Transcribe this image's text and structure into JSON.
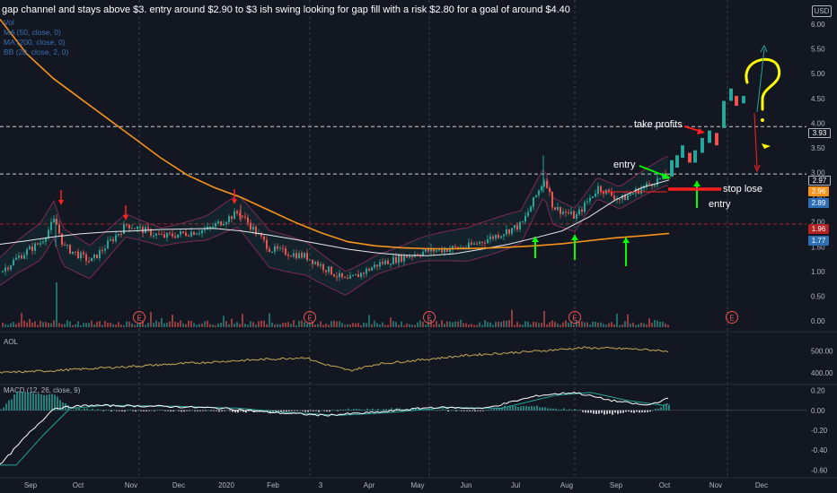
{
  "header": {
    "title": "gap channel and stays above $3. entry around $2.90 to $3 ish  swing looking for gap fill with a risk $2.80 for a goal of around $4.40",
    "currency": "USD"
  },
  "legend": {
    "vol": "Vol",
    "ma50": "MA (50, close, 0)",
    "ma200": "MA (200, close, 0)",
    "bb": "BB (20, close, 2, 0)"
  },
  "annotations": {
    "take_profits": "take profits",
    "entry_top": "entry",
    "stop_lose": "stop lose",
    "entry_bottom": "entry"
  },
  "price_tags": {
    "t393": "3.93",
    "t297": "2.97",
    "t296": "2.96",
    "t289": "2.89",
    "t196": "1.96",
    "t177": "1.77"
  },
  "colors": {
    "up": "#26a69a",
    "down": "#ef5350",
    "ma50": "#ffffff",
    "ma200": "#f7931a",
    "bb": "#7b2a55",
    "aol": "#c8a850",
    "macd": "#ffffff",
    "signal": "#26a69a",
    "tag_orange": "#f7931a",
    "tag_blue": "#2f6fb5",
    "tag_red": "#b22222"
  },
  "chart_data": [
    {
      "type": "line",
      "series": [
        {
          "name": "MA (50, close, 0)",
          "values": [
            1.55,
            1.62,
            1.7,
            1.76,
            1.8,
            1.82,
            1.85,
            1.86,
            1.87,
            1.82,
            1.74,
            1.65,
            1.55,
            1.45,
            1.38,
            1.33,
            1.32,
            1.36,
            1.45,
            1.55,
            1.68,
            1.82,
            2.1,
            2.45,
            2.7,
            2.85
          ]
        },
        {
          "name": "MA (200, close, 0)",
          "values": [
            6.1,
            5.4,
            4.9,
            4.5,
            4.1,
            3.7,
            3.3,
            2.95,
            2.7,
            2.5,
            2.25,
            2.0,
            1.78,
            1.6,
            1.52,
            1.48,
            1.46,
            1.46,
            1.47,
            1.49,
            1.52,
            1.56,
            1.62,
            1.68,
            1.72,
            1.77
          ]
        }
      ],
      "x": [
        "Sep",
        "",
        "Oct",
        "",
        "Nov",
        "",
        "Dec",
        "",
        "2020",
        "",
        "Feb",
        "",
        "3",
        "",
        "Apr",
        "",
        "May",
        "",
        "Jun",
        "",
        "Jul",
        "",
        "Aug",
        "",
        "Sep",
        "Oct"
      ],
      "xlabel": "",
      "ylabel": "",
      "x_ticks": [
        "Sep",
        "Oct",
        "Nov",
        "Dec",
        "2020",
        "Feb",
        "3",
        "Apr",
        "May",
        "Jun",
        "Jul",
        "Aug",
        "Sep",
        "Oct",
        "Nov",
        "Dec"
      ],
      "y_ticks": [
        "6.00",
        "5.50",
        "5.00",
        "4.50",
        "4.00",
        "3.50",
        "3.00",
        "2.50",
        "2.00",
        "1.50",
        "1.00",
        "0.50",
        "0.00"
      ],
      "ylim": [
        0,
        6.2
      ],
      "levels": [
        3.93,
        2.97,
        1.96
      ],
      "earnings_markers": [
        "E",
        "E",
        "E",
        "E",
        "E"
      ],
      "grid": false
    },
    {
      "type": "line",
      "title": "AOL",
      "y_ticks": [
        "500.00",
        "400.00"
      ],
      "ylim": [
        350,
        560
      ]
    },
    {
      "type": "line",
      "title": "MACD (12, 26, close, 9)",
      "y_ticks": [
        "0.20",
        "0.00",
        "-0.20",
        "-0.40",
        "-0.60"
      ],
      "ylim": [
        -0.65,
        0.25
      ]
    }
  ]
}
